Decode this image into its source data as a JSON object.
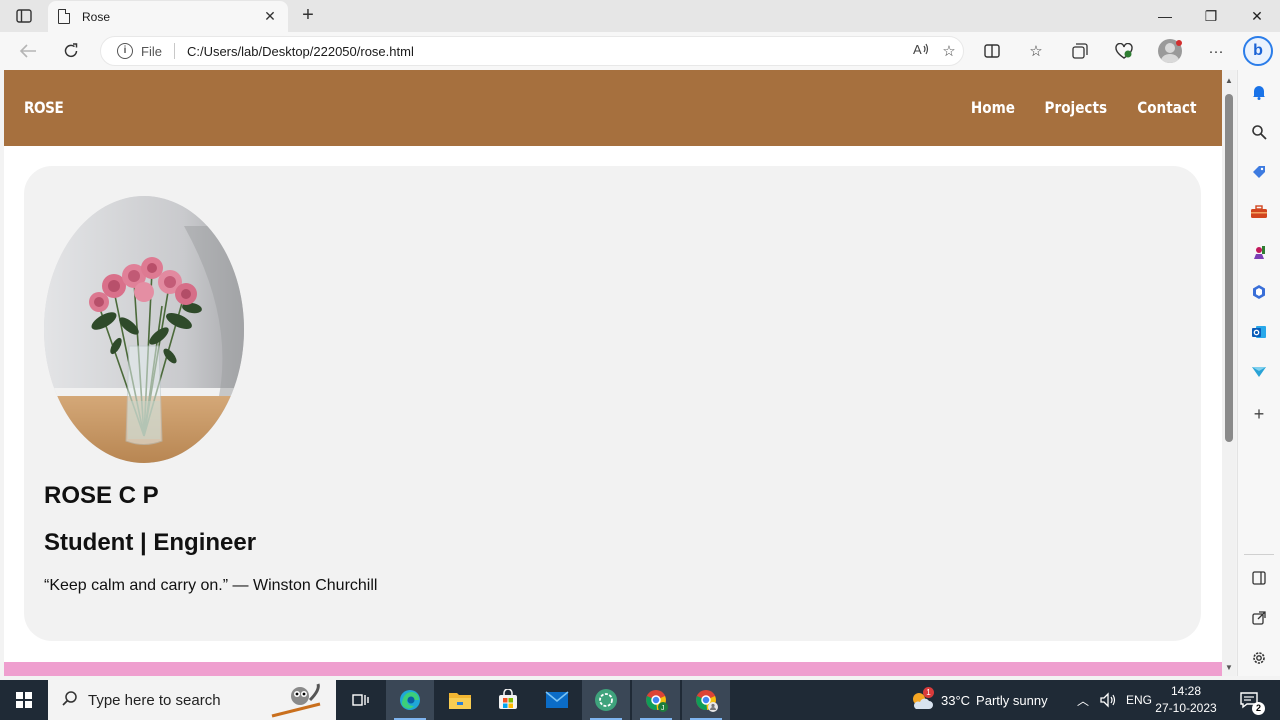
{
  "browser": {
    "tab_title": "Rose",
    "tab_close": "✕",
    "new_tab": "+",
    "window": {
      "minimize": "—",
      "restore": "❐",
      "close": "✕"
    },
    "address": {
      "protocol": "File",
      "url": "C:/Users/lab/Desktop/222050/rose.html"
    },
    "icons": [
      "back-icon",
      "refresh-icon",
      "read-aloud-icon",
      "favorite-star-icon",
      "split-screen-icon",
      "favorites-icon",
      "collections-icon",
      "browser-essentials-icon",
      "profile-avatar",
      "more-menu-icon",
      "bing-copilot-icon"
    ]
  },
  "site": {
    "brand": "ROSE",
    "nav": [
      "Home",
      "Projects",
      "Contact"
    ],
    "name": "ROSE C P",
    "role": "Student | Engineer",
    "quote": "“Keep calm and carry on.” — Winston Churchill",
    "colors": {
      "header": "#a6703e",
      "card": "#f2f2f2",
      "footer": "#ef9fcf"
    }
  },
  "sidebar": {
    "icons": [
      "notifications-icon",
      "search-icon",
      "shopping-icon",
      "tools-icon",
      "games-icon",
      "microsoft-365-icon",
      "outlook-icon",
      "drop-icon",
      "add-icon",
      "sidebar-toggle-icon",
      "external-open-icon",
      "settings-icon"
    ]
  },
  "taskbar": {
    "search_placeholder": "Type here to search",
    "weather": {
      "badge": "1",
      "temp": "33°C",
      "condition": "Partly sunny"
    },
    "language": "ENG",
    "time": "14:28",
    "date": "27-10-2023",
    "notifications": "2"
  }
}
